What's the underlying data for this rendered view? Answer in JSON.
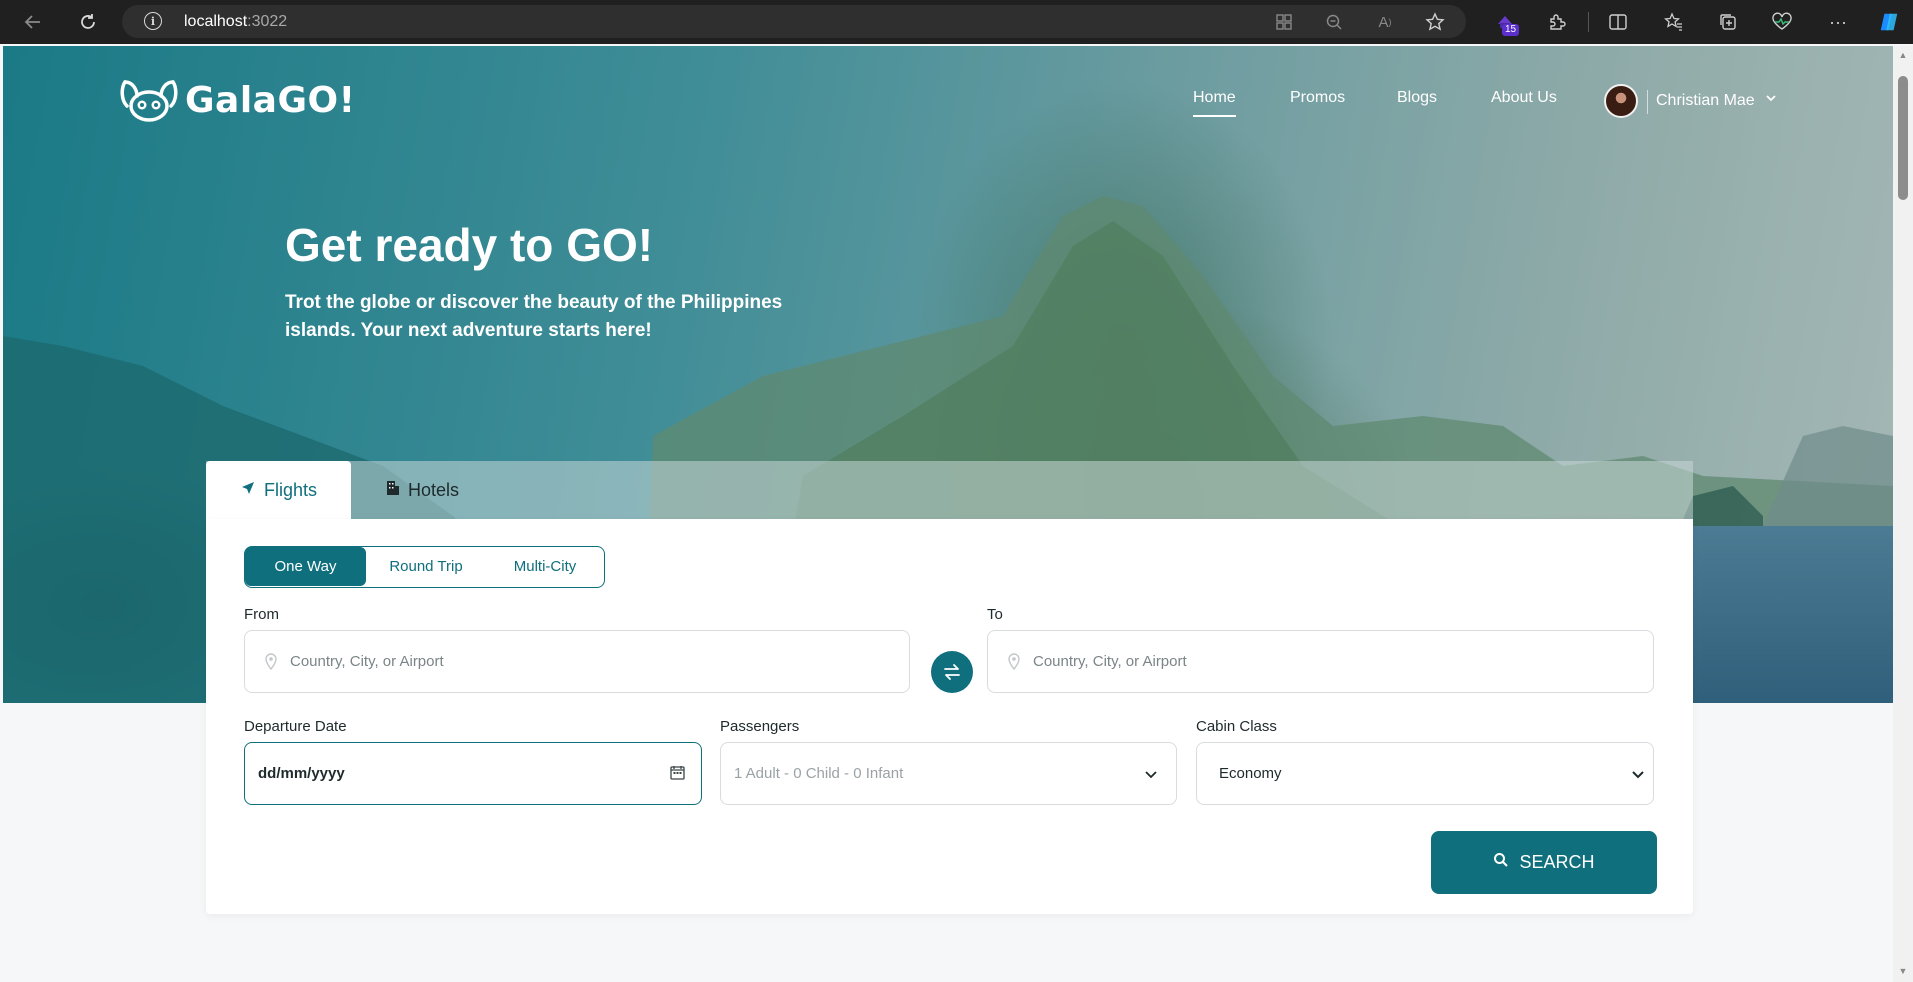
{
  "browser": {
    "url_host": "localhost",
    "url_port": ":3022",
    "extension_badge": "15",
    "icons": [
      "back-icon",
      "refresh-icon",
      "info-icon",
      "apps-icon",
      "zoom-out-icon",
      "read-aloud-icon",
      "favorite-star-icon",
      "extension-icon",
      "puzzle-icon",
      "split-screen-icon",
      "favorites-icon",
      "collections-icon",
      "health-icon",
      "more-icon",
      "copilot-icon"
    ]
  },
  "header": {
    "logo_text": "GalaGO!",
    "nav": [
      "Home",
      "Promos",
      "Blogs",
      "About Us"
    ],
    "active_nav": "Home",
    "user_name": "Christian Mae"
  },
  "hero": {
    "title": "Get ready to GO!",
    "subtitle": "Trot the globe or discover the beauty of the Philippines islands. Your next adventure starts here!"
  },
  "search": {
    "tabs": [
      "Flights",
      "Hotels"
    ],
    "active_tab": "Flights",
    "trip_types": [
      "One Way",
      "Round Trip",
      "Multi-City"
    ],
    "active_trip": "One Way",
    "from_label": "From",
    "from_placeholder": "Country, City, or Airport",
    "to_label": "To",
    "to_placeholder": "Country, City, or Airport",
    "departure_label": "Departure Date",
    "departure_value": "dd/mm/yyyy",
    "passengers_label": "Passengers",
    "passengers_value": "1 Adult - 0 Child - 0 Infant",
    "cabin_label": "Cabin Class",
    "cabin_value": "Economy",
    "search_label": "SEARCH"
  },
  "colors": {
    "primary": "#0f6f7d",
    "text": "#1e2a2c",
    "placeholder": "#7b8588"
  }
}
